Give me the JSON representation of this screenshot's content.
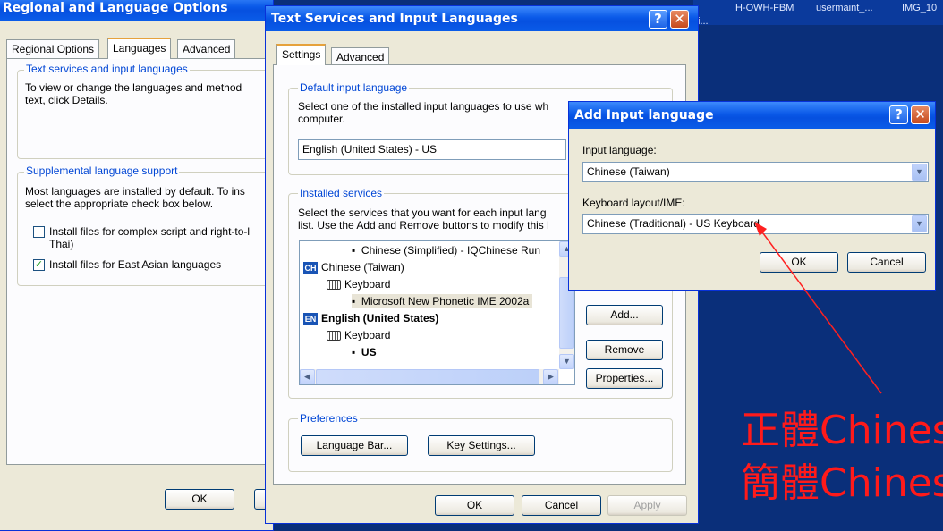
{
  "desktop": {
    "items": [
      "H-OWH-FBM",
      "usermaint_...",
      "IMG_10",
      "i..."
    ],
    "annotations": [
      "正體Chines",
      "簡體Chines"
    ],
    "annotation_color": "#ff1a1a"
  },
  "regional": {
    "title": "Regional and Language Options",
    "tabs": [
      "Regional Options",
      "Languages",
      "Advanced"
    ],
    "group1": {
      "label": "Text services and input languages",
      "text1": "To view or change the languages and method",
      "text2": "text, click Details."
    },
    "group2": {
      "label": "Supplemental language support",
      "text1": "Most languages are installed by default. To ins",
      "text2": "select the appropriate check box below.",
      "check1_l1": "Install files for complex script and right-to-l",
      "check1_l2": "Thai)",
      "check2": "Install files for East Asian languages",
      "check2_checked": "✓"
    },
    "ok": "OK"
  },
  "textsvc": {
    "title": "Text Services and Input Languages",
    "tabs": [
      "Settings",
      "Advanced"
    ],
    "default": {
      "label": "Default input language",
      "text1": "Select one of the installed input languages to use wh",
      "text2": "computer.",
      "value": "English (United States) - US"
    },
    "installed": {
      "label": "Installed services",
      "text1": "Select the services that you want for each input lang",
      "text2": "list. Use the Add and Remove buttons to modify this l",
      "items": {
        "item1": "Chinese (Simplified) - IQChinese Run",
        "lang1_code": "CH",
        "lang1": "Chinese (Taiwan)",
        "kbd1": "Keyboard",
        "ime1": "Microsoft New Phonetic IME 2002a",
        "lang2_code": "EN",
        "lang2": "English (United States)",
        "kbd2": "Keyboard",
        "layout2": "US"
      },
      "add": "Add...",
      "remove": "Remove",
      "properties": "Properties..."
    },
    "prefs": {
      "label": "Preferences",
      "langbar": "Language Bar...",
      "keysettings": "Key Settings..."
    },
    "ok": "OK",
    "cancel": "Cancel",
    "apply": "Apply"
  },
  "addlang": {
    "title": "Add Input language",
    "input_label": "Input language:",
    "input_value": "Chinese (Taiwan)",
    "kbd_label": "Keyboard layout/IME:",
    "kbd_value": "Chinese (Traditional) - US Keyboard",
    "ok": "OK",
    "cancel": "Cancel"
  }
}
